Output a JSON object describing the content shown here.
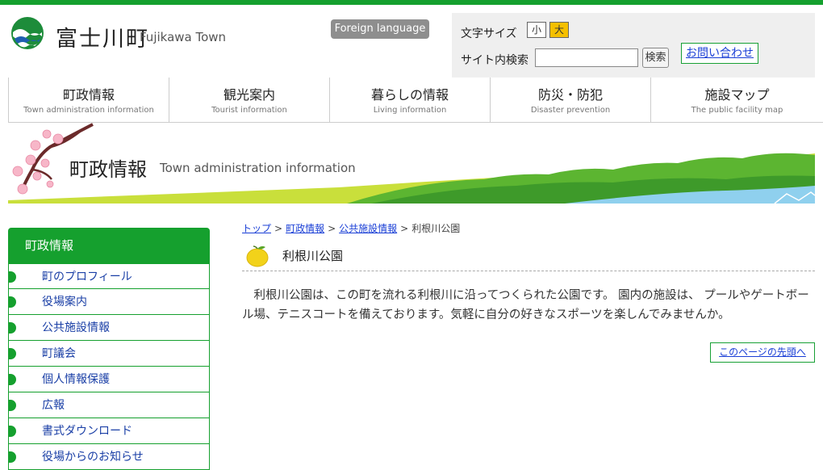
{
  "header": {
    "site_name": "富士川町",
    "site_name_en": "Fujikawa Town",
    "foreign_language": "Foreign language",
    "font_size_label": "文字サイズ",
    "font_small": "小",
    "font_large": "大",
    "search_label": "サイト内検索",
    "search_value": "",
    "search_button": "検索",
    "contact_link": "お問い合わせ"
  },
  "nav": [
    {
      "jp": "町政情報",
      "en": "Town administration information"
    },
    {
      "jp": "観光案内",
      "en": "Tourist information"
    },
    {
      "jp": "暮らしの情報",
      "en": "Living information"
    },
    {
      "jp": "防災・防犯",
      "en": "Disaster prevention"
    },
    {
      "jp": "施設マップ",
      "en": "The public facility map"
    }
  ],
  "banner": {
    "title": "町政情報",
    "subtitle": "Town administration information"
  },
  "sidebar": {
    "heading": "町政情報",
    "items": [
      {
        "label": "町のプロフィール"
      },
      {
        "label": "役場案内"
      },
      {
        "label": "公共施設情報"
      },
      {
        "label": "町議会"
      },
      {
        "label": "個人情報保護"
      },
      {
        "label": "広報"
      },
      {
        "label": "書式ダウンロード"
      },
      {
        "label": "役場からのお知らせ"
      }
    ]
  },
  "breadcrumb": {
    "items": [
      "トップ",
      "町政情報",
      "公共施設情報"
    ],
    "separator": ">",
    "current": "利根川公園"
  },
  "main": {
    "title": "利根川公園",
    "body": "利根川公園は、この町を流れる利根川に沿ってつくられた公園です。 園内の施設は、 プールやゲートボール場、テニスコートを備えております。気軽に自分の好きなスポーツを楽しんでみませんか。",
    "to_top": "このページの先頭へ"
  },
  "colors": {
    "brand_green": "#15a02e",
    "link_blue": "#1a3fd6",
    "font_large_bg": "#f5c000"
  },
  "icons": {
    "logo": "fujikawa-town-logo",
    "title_icon": "yuzu-icon",
    "list_marker": "green-bullet-icon"
  }
}
